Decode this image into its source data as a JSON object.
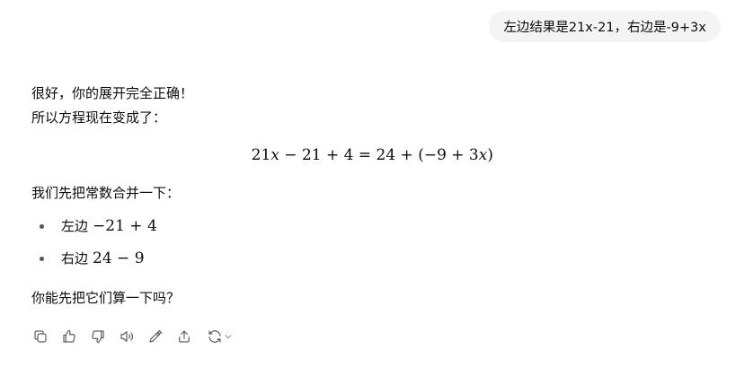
{
  "user_message": "左边结果是21x-21，右边是-9+3x",
  "assistant": {
    "line1": "很好，你的展开完全正确！",
    "line2": "所以方程现在变成了：",
    "equation": {
      "lhs_a": "21",
      "var": "x",
      "lhs_b": " − 21 + 4 = 24 + (−9 + 3",
      "var2": "x",
      "close": ")"
    },
    "line3": "我们先把常数合并一下：",
    "bullets": [
      {
        "label": "左边",
        "math": "−21 + 4"
      },
      {
        "label": "右边",
        "math": "24 − 9"
      }
    ],
    "line4": "你能先把它们算一下吗？"
  },
  "toolbar": {
    "icons": [
      "copy-icon",
      "thumbs-up-icon",
      "thumbs-down-icon",
      "read-aloud-icon",
      "edit-icon",
      "share-icon",
      "regenerate-icon"
    ]
  }
}
